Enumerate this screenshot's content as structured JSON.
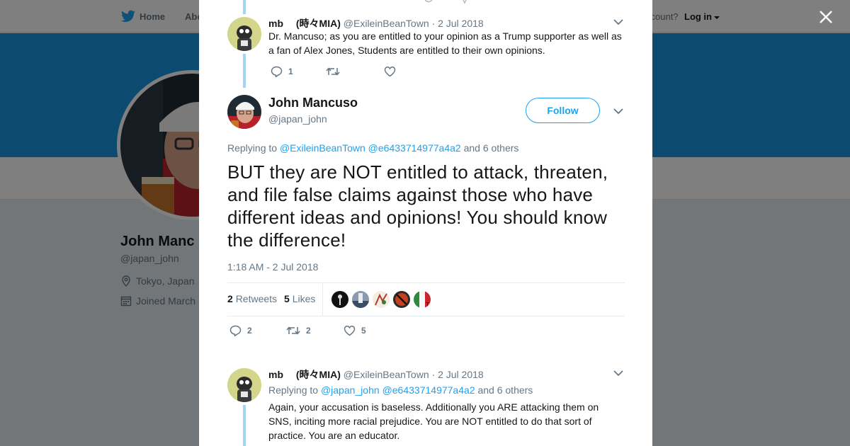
{
  "topnav": {
    "home": "Home",
    "about": "Abo",
    "account": "ccount?",
    "login": "Log in"
  },
  "profile": {
    "name": "John Manc",
    "handle": "@japan_john",
    "location": "Tokyo, Japan",
    "joined": "Joined March"
  },
  "parent_tweet": {
    "name": "mb 　(時々MIA)",
    "handle": "@ExileinBeanTown",
    "date": "· 2 Jul 2018",
    "text": "Dr. Mancuso; as you are entitled to your opinion as a Trump supporter as well as a fan of Alex Jones, Students are entitled to their own opinions.",
    "reply_count": "1"
  },
  "main_tweet": {
    "name": "John Mancuso",
    "handle": "@japan_john",
    "follow_label": "Follow",
    "replying_prefix": "Replying to",
    "replying_mentions": [
      "@ExileinBeanTown",
      "@e6433714977a4a2"
    ],
    "replying_suffix": "and 6 others",
    "text": "BUT they are NOT entitled to attack, threaten, and file false claims against those who have different ideas and opinions! You should know the difference!",
    "timestamp": "1:18 AM - 2 Jul 2018",
    "retweets_count": "2",
    "retweets_label": "Retweets",
    "likes_count": "5",
    "likes_label": "Likes",
    "reply_count": "2",
    "retweet_count": "2",
    "like_count": "5"
  },
  "reply_tweet": {
    "name": "mb 　(時々MIA)",
    "handle": "@ExileinBeanTown",
    "date": "· 2 Jul 2018",
    "replying_prefix": "Replying to",
    "replying_mentions": [
      "@japan_john",
      "@e6433714977a4a2"
    ],
    "replying_suffix": "and 6 others",
    "text": "Again, your accusation is baseless. Additionally you ARE attacking them on SNS, inciting more racial prejudice. You are NOT entitled to do that sort of practice. You are an educator."
  },
  "colors": {
    "accent": "#1da1f2",
    "banner": "#1b95e0",
    "thread_line": "#a5d4f2",
    "text_muted": "#657786"
  },
  "icons": [
    "twitter-bird-icon",
    "close-icon",
    "chevron-down-icon",
    "reply-icon",
    "retweet-icon",
    "like-icon",
    "location-pin-icon",
    "calendar-icon"
  ]
}
